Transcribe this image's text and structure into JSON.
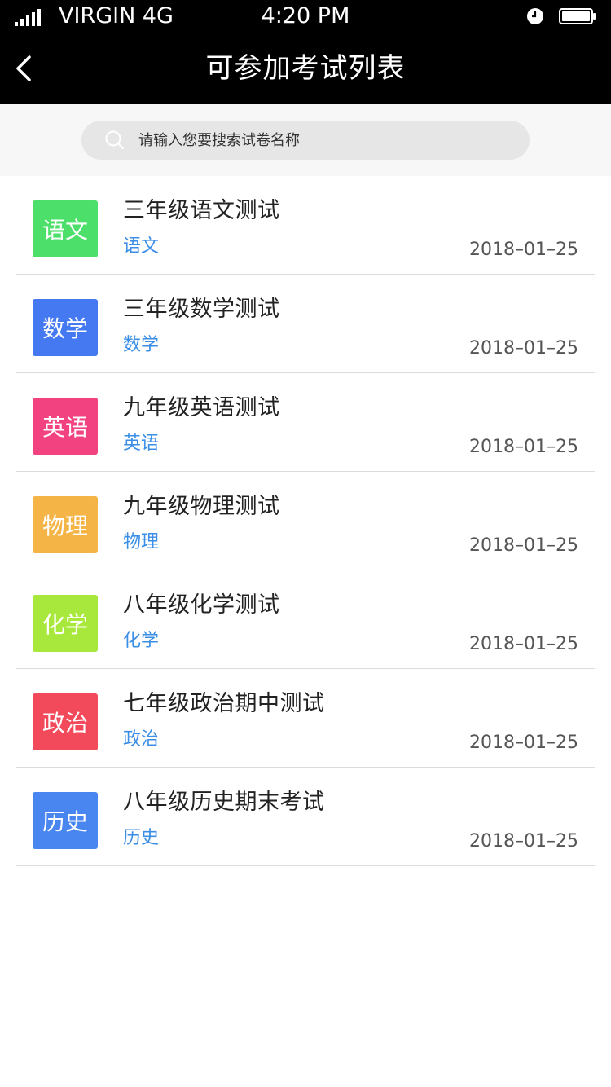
{
  "status_bar": {
    "carrier": "VIRGIN  4G",
    "time": "4:20 PM"
  },
  "nav": {
    "title": "可参加考试列表"
  },
  "search": {
    "placeholder": "请输入您要搜索试卷名称",
    "value": ""
  },
  "exams": [
    {
      "badge": "语文",
      "badge_color": "#4cdf6a",
      "title": "三年级语文测试",
      "subject": "语文",
      "date": "2018–01–25"
    },
    {
      "badge": "数学",
      "badge_color": "#4479f2",
      "title": "三年级数学测试",
      "subject": "数学",
      "date": "2018–01–25"
    },
    {
      "badge": "英语",
      "badge_color": "#f2427f",
      "title": "九年级英语测试",
      "subject": "英语",
      "date": "2018–01–25"
    },
    {
      "badge": "物理",
      "badge_color": "#f4b446",
      "title": "九年级物理测试",
      "subject": "物理",
      "date": "2018–01–25"
    },
    {
      "badge": "化学",
      "badge_color": "#a8e83c",
      "title": "八年级化学测试",
      "subject": "化学",
      "date": "2018–01–25"
    },
    {
      "badge": "政治",
      "badge_color": "#f24a5a",
      "title": "七年级政治期中测试",
      "subject": "政治",
      "date": "2018–01–25"
    },
    {
      "badge": "历史",
      "badge_color": "#4a86f0",
      "title": "八年级历史期末考试",
      "subject": "历史",
      "date": "2018–01–25"
    }
  ]
}
